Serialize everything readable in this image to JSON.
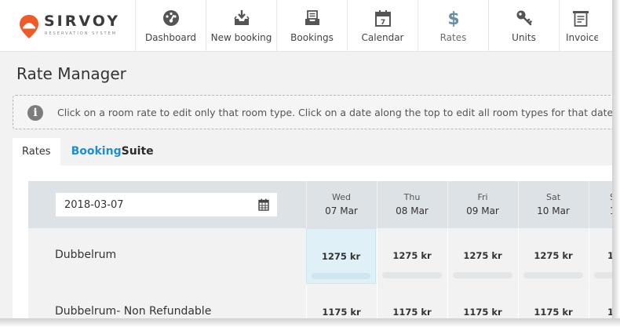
{
  "logo": {
    "name": "SIRVOY",
    "tagline": "RESERVATION SYSTEM",
    "pin_color": "#f05a28"
  },
  "nav": [
    {
      "label": "Dashboard",
      "icon": "dashboard-gauge-icon"
    },
    {
      "label": "New booking",
      "icon": "inbox-download-icon"
    },
    {
      "label": "Bookings",
      "icon": "bookings-tray-icon"
    },
    {
      "label": "Calendar",
      "icon": "calendar-icon",
      "day": "7"
    },
    {
      "label": "Rates",
      "icon": "dollar-icon",
      "active": true
    },
    {
      "label": "Units",
      "icon": "key-icon"
    },
    {
      "label": "Invoice",
      "icon": "invoice-icon"
    }
  ],
  "page": {
    "title": "Rate Manager"
  },
  "info": {
    "icon": "info-icon",
    "glyph": "i",
    "text": "Click on a room rate to edit only that room type. Click on a date along the top to edit all room types for that date"
  },
  "tabs": {
    "rates": "Rates",
    "booking_suite": {
      "part1": "Booking",
      "part2": "Suite"
    }
  },
  "grid": {
    "date_value": "2018-03-07",
    "days": [
      {
        "name": "Wed",
        "date": "07 Mar"
      },
      {
        "name": "Thu",
        "date": "08 Mar"
      },
      {
        "name": "Fri",
        "date": "09 Mar"
      },
      {
        "name": "Sat",
        "date": "10 Mar"
      },
      {
        "name": "S",
        "date": "1"
      }
    ],
    "rooms": [
      {
        "name": "Dubbelrum",
        "rates": [
          "1275 kr",
          "1275 kr",
          "1275 kr",
          "1275 kr",
          "1"
        ]
      },
      {
        "name": "Dubbelrum- Non Refundable",
        "rates": [
          "1175 kr",
          "1175 kr",
          "1175 kr",
          "1175 kr",
          "1"
        ]
      }
    ]
  },
  "colors": {
    "accent_blue": "#1b8fd0",
    "header_bg": "#dde2e6",
    "highlight": "#dff0f7",
    "icon_gray": "#555555"
  }
}
